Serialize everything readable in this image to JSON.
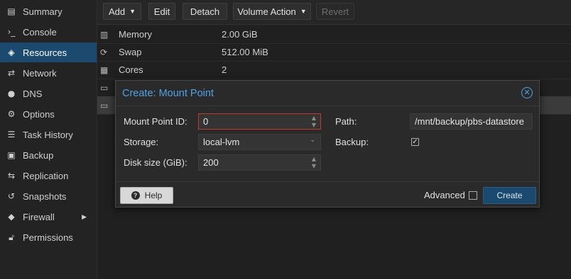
{
  "sidebar": {
    "items": [
      {
        "label": "Summary",
        "icon": "book-icon"
      },
      {
        "label": "Console",
        "icon": "terminal-icon"
      },
      {
        "label": "Resources",
        "icon": "cube-icon"
      },
      {
        "label": "Network",
        "icon": "exchange-icon"
      },
      {
        "label": "DNS",
        "icon": "globe-icon"
      },
      {
        "label": "Options",
        "icon": "gear-icon"
      },
      {
        "label": "Task History",
        "icon": "list-icon"
      },
      {
        "label": "Backup",
        "icon": "floppy-icon"
      },
      {
        "label": "Replication",
        "icon": "retweet-icon"
      },
      {
        "label": "Snapshots",
        "icon": "history-icon"
      },
      {
        "label": "Firewall",
        "icon": "shield-icon"
      },
      {
        "label": "Permissions",
        "icon": "unlock-icon"
      }
    ],
    "active": "Resources"
  },
  "toolbar": {
    "add": "Add",
    "edit": "Edit",
    "detach": "Detach",
    "volume_action": "Volume Action",
    "revert": "Revert"
  },
  "hardware": [
    {
      "name": "Memory",
      "value": "2.00 GiB",
      "icon": "memory-icon"
    },
    {
      "name": "Swap",
      "value": "512.00 MiB",
      "icon": "refresh-icon"
    },
    {
      "name": "Cores",
      "value": "2",
      "icon": "cpu-icon"
    },
    {
      "name": "",
      "value": "",
      "icon": "hdd-icon"
    },
    {
      "name": "",
      "value": "",
      "icon": "hdd-icon"
    }
  ],
  "dialog": {
    "title": "Create: Mount Point",
    "mount_point_id_label": "Mount Point ID:",
    "mount_point_id_value": "0",
    "storage_label": "Storage:",
    "storage_value": "local-lvm",
    "disk_size_label": "Disk size (GiB):",
    "disk_size_value": "200",
    "path_label": "Path:",
    "path_value": "/mnt/backup/pbs-datastore",
    "backup_label": "Backup:",
    "backup_checked": true,
    "help": "Help",
    "advanced": "Advanced",
    "create": "Create"
  },
  "colors": {
    "accent": "#4ea3e6",
    "selection": "#1b4a6e",
    "error_border": "#c0392b"
  }
}
